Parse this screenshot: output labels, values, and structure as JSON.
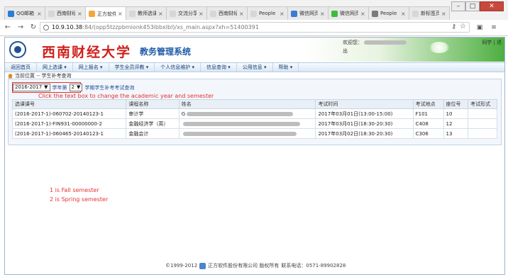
{
  "browser": {
    "tabs": [
      {
        "label": "QQ邮箱",
        "color": "#2b7fd6",
        "active": false
      },
      {
        "label": "西南财经",
        "color": "#d7d7d7",
        "active": false
      },
      {
        "label": "正方软件",
        "color": "#f4a63a",
        "active": true
      },
      {
        "label": "教师选课",
        "color": "#d7d7d7",
        "active": false
      },
      {
        "label": "交流分享",
        "color": "#d7d7d7",
        "active": false
      },
      {
        "label": "西南财经",
        "color": "#d7d7d7",
        "active": false
      },
      {
        "label": "People",
        "color": "#d7d7d7",
        "active": false
      },
      {
        "label": "微信网页",
        "color": "#3a7bd5",
        "active": false
      },
      {
        "label": "微信网页",
        "color": "#3dbb3d",
        "active": false
      },
      {
        "label": "People",
        "color": "#7a7a7a",
        "active": false
      },
      {
        "label": "新标签页",
        "color": "#d7d7d7",
        "active": false
      }
    ],
    "address": {
      "host": "10.9.10.38",
      "rest": ":84/(opp5tzzpbmionk453ibbxlbl)/xs_main.aspx?xh=51400391"
    }
  },
  "header": {
    "university": "西南财经大学",
    "system_name": "教务管理系统",
    "welcome": "欢迎您：",
    "user_suffix": "出",
    "right_links": "同学 | 退"
  },
  "menu": [
    "返回首页",
    "网上选课 ▾",
    "网上报名 ▾",
    "学生全员评教 ▾",
    "个人信息维护 ▾",
    "信息查询 ▾",
    "公用信息 ▾",
    "帮助 ▾"
  ],
  "breadcrumb": "当前位置 -- 学生补考查询",
  "filters": {
    "year_value": "2016-2017",
    "year_suffix": "学年第",
    "semester_value": "2",
    "semester_suffix": "学期学生补考考试查询"
  },
  "annotations": {
    "click_hint": "Click the text box to change the academic year and semester",
    "fall": "1 is Fall semester",
    "spring": "2 is Spring semester"
  },
  "table": {
    "headers": [
      "选课课号",
      "课程名称",
      "姓名",
      "考试时间",
      "考试地点",
      "座位号",
      "考试形式"
    ],
    "rows": [
      [
        "(2016-2017-1)-060702-20140123-1",
        "审计学",
        "G",
        "2017年03月01日(13:00-15:00)",
        "F101",
        "10",
        ""
      ],
      [
        "(2016-2017-1)-FIN931-00000000-2",
        "金融经济学（英）",
        "",
        "2017年03月01日(18:30-20:30)",
        "C408",
        "12",
        ""
      ],
      [
        "(2016-2017-1)-060465-20140123-1",
        "金融会计",
        "",
        "2017年03月02日(18:30-20:30)",
        "C306",
        "13",
        ""
      ]
    ]
  },
  "footer": {
    "copyright": "©1999-2012",
    "company": "正方软件股份有限公司 版权所有",
    "phone": "联系电话：0571-89902828"
  }
}
